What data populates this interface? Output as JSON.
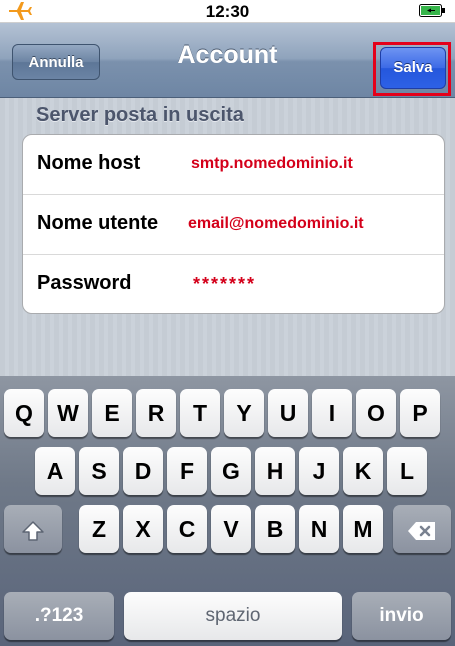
{
  "status_bar": {
    "time": "12:30",
    "plane_icon": "airplane-icon",
    "battery_icon": "battery-icon",
    "plane_color": "#f39a1d"
  },
  "nav_bar": {
    "title": "Account",
    "cancel_label": "Annulla",
    "save_label": "Salva",
    "highlight_color": "#e4001a"
  },
  "form": {
    "section_title": "Server posta in uscita",
    "rows": [
      {
        "label": "Nome host",
        "value": "smtp.nomedominio.it"
      },
      {
        "label": "Nome utente",
        "value": "email@nomedominio.it"
      },
      {
        "label": "Password",
        "value": "*******"
      }
    ],
    "value_color": "#d4001a"
  },
  "keyboard": {
    "row1": [
      "Q",
      "W",
      "E",
      "R",
      "T",
      "Y",
      "U",
      "I",
      "O",
      "P"
    ],
    "row2": [
      "A",
      "S",
      "D",
      "F",
      "G",
      "H",
      "J",
      "K",
      "L"
    ],
    "row3": [
      "Z",
      "X",
      "C",
      "V",
      "B",
      "N",
      "M"
    ],
    "shift_icon": "shift-arrow-icon",
    "backspace_icon": "backspace-icon",
    "numbers_label": ".?123",
    "space_label": "spazio",
    "return_label": "invio"
  }
}
